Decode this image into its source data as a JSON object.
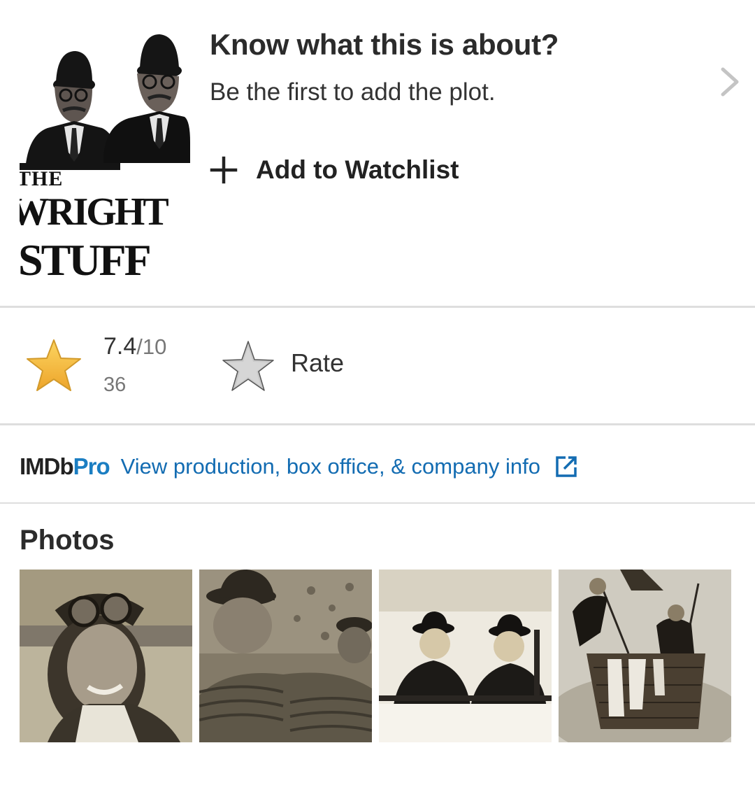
{
  "plot": {
    "title": "Know what this is about?",
    "subtitle": "Be the first to add the plot.",
    "watchlist_label": "Add to Watchlist",
    "poster_text": [
      "THE",
      "WRIGHT",
      "STUFF"
    ]
  },
  "rating": {
    "value": "7.4",
    "max": "/10",
    "count": "36",
    "rate_label": "Rate",
    "rated_star_color": "#f5c518",
    "unrated_star_color": "#c8c8c8"
  },
  "imdbpro": {
    "logo_imdb": "IMDb",
    "logo_pro": "Pro",
    "link_text": "View production, box office, & company info",
    "link_color": "#136cb2"
  },
  "photos": {
    "title": "Photos",
    "items": [
      "photo-aviator-woman",
      "photo-men-with-ropes",
      "photo-men-in-plane",
      "photo-balloon-basket"
    ]
  },
  "icons": [
    "chevron-right-icon",
    "plus-icon",
    "star-icon",
    "external-link-icon"
  ]
}
